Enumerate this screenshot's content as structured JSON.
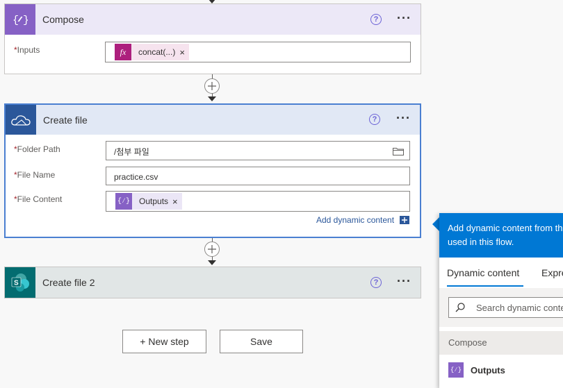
{
  "compose": {
    "title": "Compose",
    "inputs_label": "Inputs",
    "token_label": "concat(...)",
    "token_icon": "fx-icon",
    "color": "#8661c5"
  },
  "create_file": {
    "title": "Create file",
    "folder_path_label": "Folder Path",
    "folder_path_value": "/첨부 파일",
    "file_name_label": "File Name",
    "file_name_value": "practice.csv",
    "file_content_label": "File Content",
    "file_content_token": "Outputs",
    "add_dynamic": "Add dynamic content",
    "color": "#2b579a"
  },
  "create_file_2": {
    "title": "Create file 2",
    "color": "#036c70"
  },
  "required_mark": "*",
  "close_x": "×",
  "buttons": {
    "new_step": "+ New step",
    "save": "Save"
  },
  "dynamic_panel": {
    "header_line1": "Add dynamic content from th",
    "header_line2": "used in this flow.",
    "tab_dynamic": "Dynamic content",
    "tab_expression": "Expre",
    "search_placeholder": "Search dynamic conte",
    "section": "Compose",
    "item": "Outputs"
  },
  "colors": {
    "accent": "#0078d4",
    "compose_header": "#ece8f7",
    "create_header": "#e1e8f5",
    "create2_header": "#e1e6e6"
  }
}
